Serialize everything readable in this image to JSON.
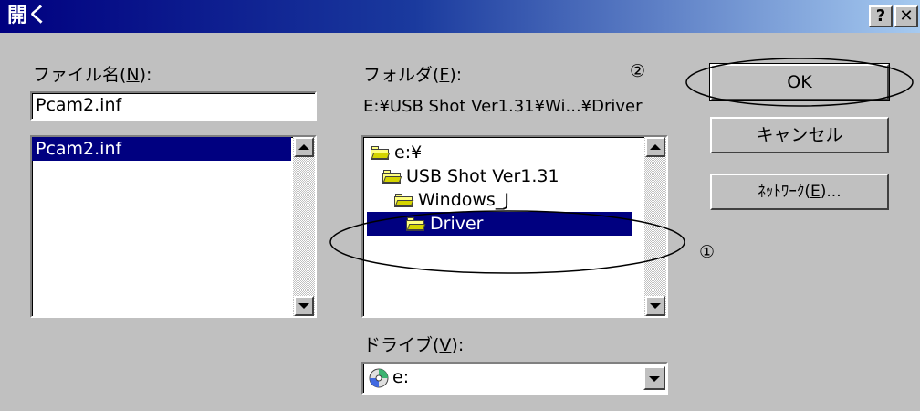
{
  "window": {
    "title": "開く",
    "help_glyph": "?",
    "close_glyph": "✕"
  },
  "filename": {
    "label_pre": "ファイル名(",
    "label_key": "N",
    "label_post": "):",
    "value": "Pcam2.inf",
    "list": [
      "Pcam2.inf"
    ]
  },
  "folder": {
    "label_pre": "フォルダ(",
    "label_key": "F",
    "label_post": "):",
    "current_path": "E:¥USB Shot Ver1.31¥Wi...¥Driver",
    "tree": [
      {
        "label": "e:¥",
        "level": 0,
        "open": true
      },
      {
        "label": "USB Shot Ver1.31",
        "level": 1,
        "open": true
      },
      {
        "label": "Windows_J",
        "level": 2,
        "open": true
      },
      {
        "label": "Driver",
        "level": 3,
        "open": true,
        "selected": true
      }
    ]
  },
  "drive": {
    "label_pre": "ドライブ(",
    "label_key": "V",
    "label_post": "):",
    "value": "e:"
  },
  "buttons": {
    "ok": "OK",
    "cancel": "キャンセル",
    "network_pre": "ﾈｯﾄﾜｰｸ(",
    "network_key": "E",
    "network_post": ")..."
  },
  "annotations": {
    "marker_1": "①",
    "marker_2": "②"
  },
  "colors": {
    "title_start": "#000080",
    "selection": "#000080",
    "face": "#c0c0c0"
  },
  "icons": {
    "folder": "open-folder-icon",
    "drive": "cd-drive-icon"
  }
}
